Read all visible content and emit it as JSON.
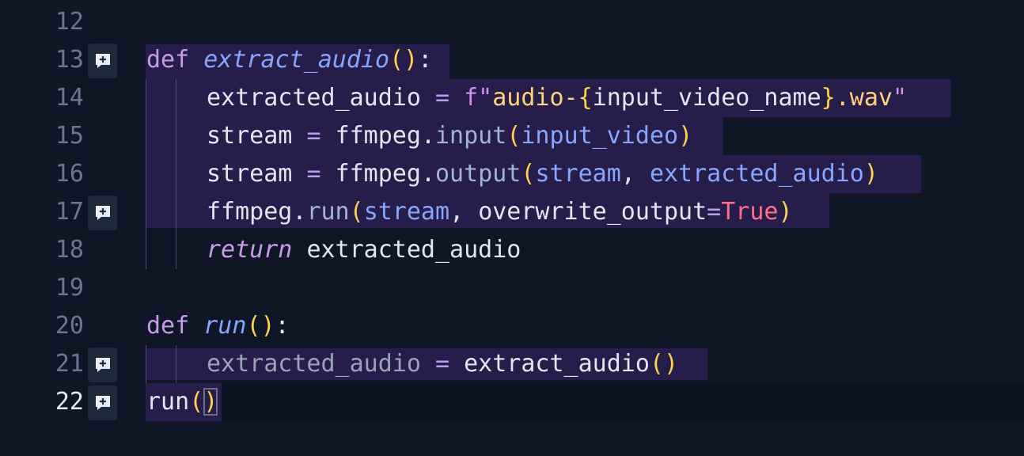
{
  "editor": {
    "line_numbers": [
      "12",
      "13",
      "14",
      "15",
      "16",
      "17",
      "18",
      "19",
      "20",
      "21",
      "22"
    ],
    "active_line": "22",
    "comment_icon": "add-comment-icon",
    "comment_icon_lines": [
      "13",
      "17",
      "21",
      "22"
    ]
  },
  "code": {
    "l13": {
      "def": "def",
      "name": "extract_audio",
      "open": "(",
      "close": ")",
      "colon": ":"
    },
    "l14": {
      "target": "extracted_audio",
      "eq": "=",
      "fprefix": "f\"",
      "str_a": "audio-",
      "brace_open": "{",
      "expr": "input_video_name",
      "brace_close": "}",
      "str_b": ".wav",
      "quote": "\""
    },
    "l15": {
      "target": "stream",
      "eq": "=",
      "obj": "ffmpeg",
      "dot": ".",
      "method": "input",
      "open": "(",
      "arg": "input_video",
      "close": ")"
    },
    "l16": {
      "target": "stream",
      "eq": "=",
      "obj": "ffmpeg",
      "dot": ".",
      "method": "output",
      "open": "(",
      "arg1": "stream",
      "comma": ",",
      "arg2": "extracted_audio",
      "close": ")"
    },
    "l17": {
      "obj": "ffmpeg",
      "dot": ".",
      "method": "run",
      "open": "(",
      "arg1": "stream",
      "comma": ",",
      "kwarg": "overwrite_output",
      "eq": "=",
      "value": "True",
      "close": ")"
    },
    "l18": {
      "keyword": "return",
      "value": "extracted_audio"
    },
    "l20": {
      "def": "def",
      "name": "run",
      "open": "(",
      "close": ")",
      "colon": ":"
    },
    "l21": {
      "target": "extracted_audio",
      "eq": "=",
      "call": "extract_audio",
      "open": "(",
      "close": ")"
    },
    "l22": {
      "call": "run",
      "open": "(",
      "close": ")"
    }
  }
}
